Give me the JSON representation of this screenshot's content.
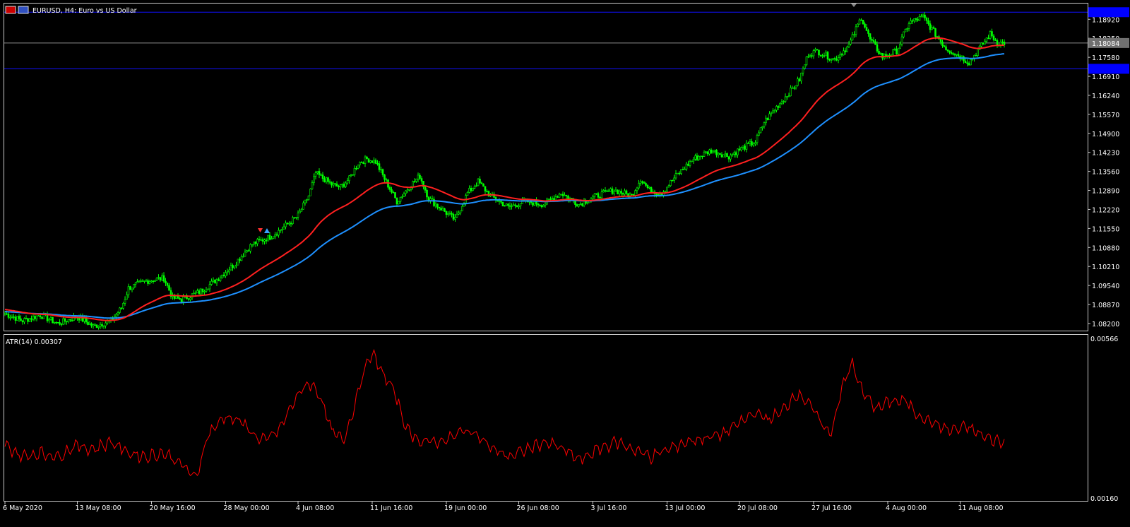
{
  "window": {
    "title": "EURUSD, H4:  Euro vs US Dollar"
  },
  "colors": {
    "background": "#000000",
    "frame": "#c8c8c8",
    "bull_candle": "#00ff00",
    "bear_candle": "#00ff00",
    "ma_fast": "#ff2020",
    "ma_slow": "#1e90ff",
    "atr_line": "#ff0000",
    "hline": "#1010ff",
    "bid_line": "#8c8c8c",
    "price_tag_blue": "#0000ff",
    "price_tag_gray": "#707070"
  },
  "price_panel": {
    "price_min": 1.0795,
    "price_max": 1.1945,
    "y_ticks": [
      "1.18920",
      "1.18250",
      "1.17580",
      "1.16910",
      "1.16240",
      "1.15570",
      "1.14900",
      "1.14230",
      "1.13560",
      "1.12890",
      "1.12220",
      "1.11550",
      "1.10880",
      "1.10210",
      "1.09540",
      "1.08870",
      "1.08200"
    ],
    "y_tick_values": [
      1.1892,
      1.1825,
      1.1758,
      1.1691,
      1.1624,
      1.1557,
      1.149,
      1.1423,
      1.1356,
      1.1289,
      1.1222,
      1.1155,
      1.1088,
      1.1021,
      1.0954,
      1.0887,
      1.082
    ],
    "current_price": "1.18084",
    "current_price_value": 1.18084,
    "upper_hline_value": 1.1917,
    "lower_hline_value": 1.17175,
    "upper_hline_label": "",
    "lower_hline_label": ""
  },
  "atr_panel": {
    "label": "ATR(14) 0.00307",
    "top_tick": "0.00566",
    "bottom_tick": "0.00160",
    "val_min": 0.0016,
    "val_max": 0.00566
  },
  "x_axis": {
    "labels": [
      "6 May 2020",
      "13 May 08:00",
      "20 May 16:00",
      "28 May 00:00",
      "4 Jun 08:00",
      "11 Jun 16:00",
      "19 Jun 00:00",
      "26 Jun 08:00",
      "3 Jul 16:00",
      "13 Jul 00:00",
      "20 Jul 08:00",
      "27 Jul 16:00",
      "4 Aug 00:00",
      "11 Aug 08:00"
    ],
    "label_bar_index": [
      0,
      41,
      83,
      125,
      166,
      208,
      250,
      291,
      333,
      375,
      416,
      458,
      500,
      541
    ]
  },
  "chart_data": {
    "type": "candlestick",
    "symbol": "EURUSD",
    "timeframe": "H4",
    "bars": 567,
    "close_keypoints": [
      [
        0,
        1.0855
      ],
      [
        10,
        1.083
      ],
      [
        20,
        1.085
      ],
      [
        30,
        1.082
      ],
      [
        41,
        1.0845
      ],
      [
        50,
        1.081
      ],
      [
        60,
        1.083
      ],
      [
        66,
        1.0875
      ],
      [
        70,
        1.0945
      ],
      [
        80,
        1.097
      ],
      [
        90,
        1.098
      ],
      [
        95,
        1.091
      ],
      [
        100,
        1.0905
      ],
      [
        110,
        1.093
      ],
      [
        120,
        1.0975
      ],
      [
        130,
        1.103
      ],
      [
        140,
        1.11
      ],
      [
        150,
        1.1125
      ],
      [
        156,
        1.115
      ],
      [
        166,
        1.12
      ],
      [
        172,
        1.127
      ],
      [
        176,
        1.135
      ],
      [
        185,
        1.131
      ],
      [
        190,
        1.13
      ],
      [
        195,
        1.133
      ],
      [
        200,
        1.1385
      ],
      [
        205,
        1.14
      ],
      [
        210,
        1.139
      ],
      [
        215,
        1.133
      ],
      [
        222,
        1.125
      ],
      [
        230,
        1.131
      ],
      [
        235,
        1.134
      ],
      [
        240,
        1.126
      ],
      [
        250,
        1.121
      ],
      [
        255,
        1.1185
      ],
      [
        262,
        1.128
      ],
      [
        268,
        1.132
      ],
      [
        275,
        1.127
      ],
      [
        285,
        1.123
      ],
      [
        295,
        1.125
      ],
      [
        305,
        1.124
      ],
      [
        315,
        1.128
      ],
      [
        325,
        1.124
      ],
      [
        335,
        1.127
      ],
      [
        345,
        1.129
      ],
      [
        355,
        1.127
      ],
      [
        360,
        1.133
      ],
      [
        365,
        1.129
      ],
      [
        372,
        1.128
      ],
      [
        380,
        1.134
      ],
      [
        390,
        1.14
      ],
      [
        400,
        1.143
      ],
      [
        410,
        1.141
      ],
      [
        418,
        1.144
      ],
      [
        425,
        1.146
      ],
      [
        430,
        1.153
      ],
      [
        438,
        1.159
      ],
      [
        445,
        1.164
      ],
      [
        450,
        1.168
      ],
      [
        455,
        1.177
      ],
      [
        460,
        1.178
      ],
      [
        470,
        1.175
      ],
      [
        478,
        1.18
      ],
      [
        485,
        1.19
      ],
      [
        490,
        1.182
      ],
      [
        497,
        1.176
      ],
      [
        505,
        1.178
      ],
      [
        512,
        1.188
      ],
      [
        520,
        1.19
      ],
      [
        527,
        1.184
      ],
      [
        533,
        1.179
      ],
      [
        540,
        1.1765
      ],
      [
        546,
        1.174
      ],
      [
        552,
        1.179
      ],
      [
        558,
        1.184
      ],
      [
        562,
        1.181
      ],
      [
        567,
        1.1808
      ]
    ],
    "ma_fast_label": "",
    "ma_slow_label": "",
    "atr_keypoints": [
      [
        0,
        0.003
      ],
      [
        10,
        0.0027
      ],
      [
        20,
        0.0028
      ],
      [
        30,
        0.0027
      ],
      [
        40,
        0.003
      ],
      [
        50,
        0.0029
      ],
      [
        60,
        0.0031
      ],
      [
        70,
        0.0028
      ],
      [
        80,
        0.0027
      ],
      [
        90,
        0.0028
      ],
      [
        100,
        0.0025
      ],
      [
        108,
        0.0021
      ],
      [
        115,
        0.0033
      ],
      [
        125,
        0.0038
      ],
      [
        135,
        0.0036
      ],
      [
        145,
        0.0031
      ],
      [
        155,
        0.0034
      ],
      [
        165,
        0.0043
      ],
      [
        172,
        0.0047
      ],
      [
        178,
        0.0044
      ],
      [
        185,
        0.0034
      ],
      [
        192,
        0.0031
      ],
      [
        198,
        0.0041
      ],
      [
        203,
        0.005
      ],
      [
        208,
        0.0055
      ],
      [
        212,
        0.0051
      ],
      [
        220,
        0.0045
      ],
      [
        228,
        0.0034
      ],
      [
        236,
        0.0031
      ],
      [
        245,
        0.0031
      ],
      [
        252,
        0.0032
      ],
      [
        260,
        0.0034
      ],
      [
        268,
        0.0033
      ],
      [
        276,
        0.0029
      ],
      [
        286,
        0.0027
      ],
      [
        296,
        0.0029
      ],
      [
        306,
        0.0031
      ],
      [
        316,
        0.0029
      ],
      [
        326,
        0.0026
      ],
      [
        336,
        0.0029
      ],
      [
        346,
        0.0031
      ],
      [
        356,
        0.0029
      ],
      [
        366,
        0.0027
      ],
      [
        376,
        0.0029
      ],
      [
        386,
        0.0031
      ],
      [
        396,
        0.0032
      ],
      [
        406,
        0.0033
      ],
      [
        416,
        0.0036
      ],
      [
        425,
        0.0039
      ],
      [
        432,
        0.0037
      ],
      [
        440,
        0.0039
      ],
      [
        448,
        0.0044
      ],
      [
        455,
        0.0042
      ],
      [
        462,
        0.0036
      ],
      [
        468,
        0.0033
      ],
      [
        474,
        0.0046
      ],
      [
        480,
        0.0052
      ],
      [
        486,
        0.0044
      ],
      [
        494,
        0.004
      ],
      [
        502,
        0.0042
      ],
      [
        510,
        0.0042
      ],
      [
        518,
        0.0038
      ],
      [
        526,
        0.0036
      ],
      [
        535,
        0.0034
      ],
      [
        545,
        0.0035
      ],
      [
        556,
        0.0032
      ],
      [
        566,
        0.00307
      ]
    ]
  }
}
